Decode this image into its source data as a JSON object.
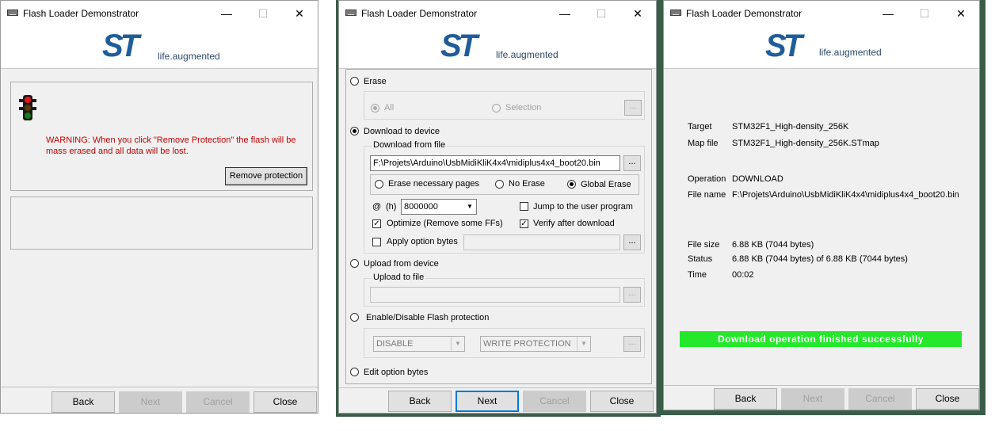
{
  "colors": {
    "st_dark_blue": "#1f5d9a",
    "st_light_blue": "#3ca4dc",
    "warning_red": "#c00000",
    "success_green": "#25e82d"
  },
  "logo": {
    "mark": "ST",
    "tagline_a": "life",
    "tagline_b": ".augmented"
  },
  "window_controls": {
    "minimize": "—",
    "maximize": "☐",
    "close": "✕"
  },
  "browse_label": "...",
  "win1": {
    "title": "Flash Loader Demonstrator",
    "warning": "WARNING: When you click \"Remove Protection\" the flash will be mass erased and all data will be lost.",
    "remove_button": "Remove protection",
    "icon": "traffic-light-icon",
    "buttons": {
      "back": "Back",
      "next": "Next",
      "cancel": "Cancel",
      "close": "Close"
    }
  },
  "win2": {
    "title": "Flash Loader Demonstrator",
    "erase": {
      "label": "Erase",
      "all": "All",
      "selection": "Selection"
    },
    "download": {
      "label": "Download to device",
      "group": "Download from file",
      "file": "F:\\Projets\\Arduino\\UsbMidiKliK4x4\\midiplus4x4_boot20.bin",
      "erase_necessary": "Erase necessary pages",
      "no_erase": "No Erase",
      "global_erase": "Global Erase",
      "at": "@",
      "hex": "(h)",
      "address": "8000000",
      "jump": "Jump to the user program",
      "optimize": "Optimize (Remove some FFs)",
      "verify": "Verify after download",
      "apply_option": "Apply option bytes"
    },
    "upload": {
      "label": "Upload from device",
      "group": "Upload to file"
    },
    "protection": {
      "label": "Enable/Disable Flash protection",
      "mode": "DISABLE",
      "type": "WRITE PROTECTION"
    },
    "edit_option": "Edit option bytes",
    "buttons": {
      "back": "Back",
      "next": "Next",
      "cancel": "Cancel",
      "close": "Close"
    }
  },
  "win3": {
    "title": "Flash Loader Demonstrator",
    "target_label": "Target",
    "target_value": "STM32F1_High-density_256K",
    "mapfile_label": "Map file",
    "mapfile_value": "STM32F1_High-density_256K.STmap",
    "operation_label": "Operation",
    "operation_value": "DOWNLOAD",
    "filename_label": "File name",
    "filename_value": "F:\\Projets\\Arduino\\UsbMidiKliK4x4\\midiplus4x4_boot20.bin",
    "filesize_label": "File size",
    "filesize_value": "6.88 KB (7044 bytes)",
    "status_label": "Status",
    "status_value": "6.88 KB (7044 bytes) of 6.88 KB (7044 bytes)",
    "time_label": "Time",
    "time_value": "00:02",
    "progress_fraction": 1.0,
    "result": "Download operation finished successfully",
    "buttons": {
      "back": "Back",
      "next": "Next",
      "cancel": "Cancel",
      "close": "Close"
    }
  }
}
